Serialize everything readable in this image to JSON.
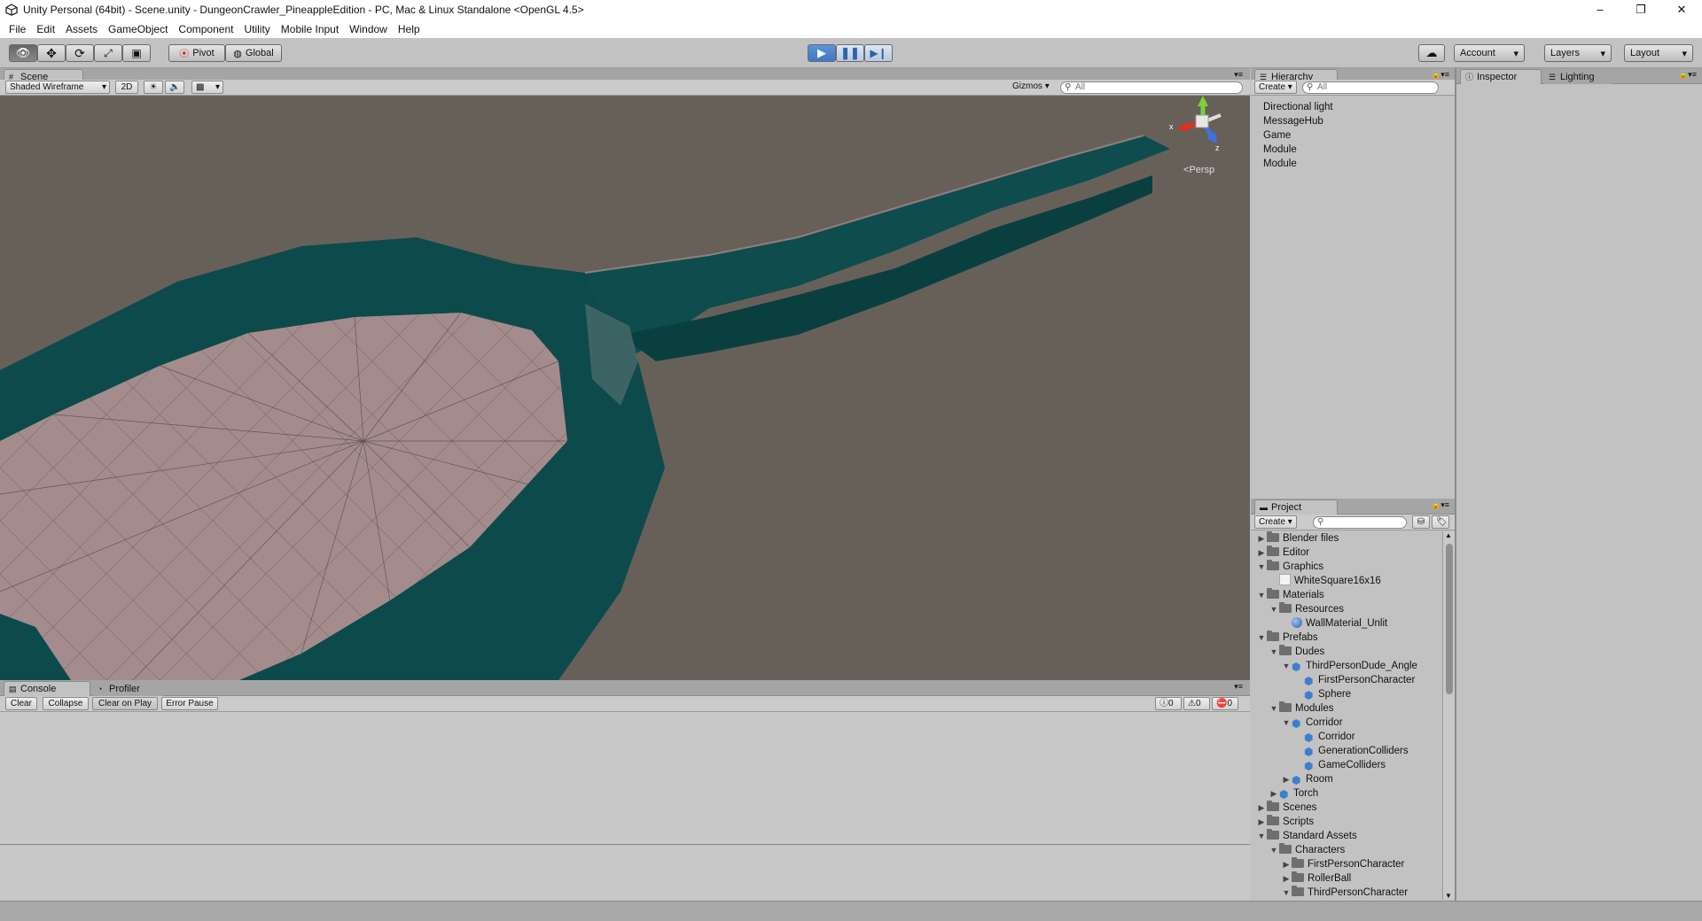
{
  "window": {
    "title": "Unity Personal (64bit) - Scene.unity - DungeonCrawler_PineappleEdition - PC, Mac & Linux Standalone <OpenGL 4.5>",
    "minimize": "–",
    "maximize": "❐",
    "close": "✕"
  },
  "menu": [
    "File",
    "Edit",
    "Assets",
    "GameObject",
    "Component",
    "Utility",
    "Mobile Input",
    "Window",
    "Help"
  ],
  "toolbar": {
    "pivot": "Pivot",
    "global": "Global",
    "account": "Account",
    "layers": "Layers",
    "layout": "Layout",
    "dropdown_arrow": "▾"
  },
  "scene": {
    "tab": "Scene",
    "shading_mode": "Shaded Wireframe",
    "mode_2d": "2D",
    "gizmos": "Gizmos",
    "search_placeholder": "All",
    "gizmo_y": "y",
    "gizmo_x": "x",
    "gizmo_z": "z",
    "projection": "Persp"
  },
  "hierarchy": {
    "tab": "Hierarchy",
    "create": "Create",
    "search_placeholder": "All",
    "items": [
      "Directional light",
      "MessageHub",
      "Game",
      "Module",
      "Module"
    ]
  },
  "inspector": {
    "tab": "Inspector",
    "lighting_tab": "Lighting"
  },
  "console": {
    "tab": "Console",
    "profiler_tab": "Profiler",
    "buttons": [
      "Clear",
      "Collapse",
      "Clear on Play",
      "Error Pause"
    ],
    "counts": {
      "info": "0",
      "warning": "0",
      "error": "0"
    }
  },
  "project": {
    "tab": "Project",
    "create": "Create",
    "tree": [
      {
        "depth": 0,
        "arrow": "▶",
        "icon": "folder",
        "label": "Blender files"
      },
      {
        "depth": 0,
        "arrow": "▶",
        "icon": "folder",
        "label": "Editor"
      },
      {
        "depth": 0,
        "arrow": "▼",
        "icon": "folder",
        "label": "Graphics"
      },
      {
        "depth": 1,
        "arrow": "",
        "icon": "texture",
        "label": "WhiteSquare16x16"
      },
      {
        "depth": 0,
        "arrow": "▼",
        "icon": "folder",
        "label": "Materials"
      },
      {
        "depth": 1,
        "arrow": "▼",
        "icon": "folder",
        "label": "Resources"
      },
      {
        "depth": 2,
        "arrow": "",
        "icon": "material",
        "label": "WallMaterial_Unlit"
      },
      {
        "depth": 0,
        "arrow": "▼",
        "icon": "folder",
        "label": "Prefabs"
      },
      {
        "depth": 1,
        "arrow": "▼",
        "icon": "folder",
        "label": "Dudes"
      },
      {
        "depth": 2,
        "arrow": "▼",
        "icon": "prefab",
        "label": "ThirdPersonDude_Angle"
      },
      {
        "depth": 3,
        "arrow": "",
        "icon": "prefab",
        "label": "FirstPersonCharacter"
      },
      {
        "depth": 3,
        "arrow": "",
        "icon": "prefab",
        "label": "Sphere"
      },
      {
        "depth": 1,
        "arrow": "▼",
        "icon": "folder",
        "label": "Modules"
      },
      {
        "depth": 2,
        "arrow": "▼",
        "icon": "prefab",
        "label": "Corridor"
      },
      {
        "depth": 3,
        "arrow": "",
        "icon": "prefab",
        "label": "Corridor"
      },
      {
        "depth": 3,
        "arrow": "",
        "icon": "prefab",
        "label": "GenerationColliders"
      },
      {
        "depth": 3,
        "arrow": "",
        "icon": "prefab",
        "label": "GameColliders"
      },
      {
        "depth": 2,
        "arrow": "▶",
        "icon": "prefab",
        "label": "Room"
      },
      {
        "depth": 1,
        "arrow": "▶",
        "icon": "prefab",
        "label": "Torch"
      },
      {
        "depth": 0,
        "arrow": "▶",
        "icon": "folder",
        "label": "Scenes"
      },
      {
        "depth": 0,
        "arrow": "▶",
        "icon": "folder",
        "label": "Scripts"
      },
      {
        "depth": 0,
        "arrow": "▼",
        "icon": "folder",
        "label": "Standard Assets"
      },
      {
        "depth": 1,
        "arrow": "▼",
        "icon": "folder",
        "label": "Characters"
      },
      {
        "depth": 2,
        "arrow": "▶",
        "icon": "folder",
        "label": "FirstPersonCharacter"
      },
      {
        "depth": 2,
        "arrow": "▶",
        "icon": "folder",
        "label": "RollerBall"
      },
      {
        "depth": 2,
        "arrow": "▼",
        "icon": "folder",
        "label": "ThirdPersonCharacter"
      }
    ]
  },
  "colors": {
    "wall": "#0d4a4b",
    "floor": "#a48c8c",
    "sky": "#676059",
    "play_active": "#3f79c4"
  }
}
